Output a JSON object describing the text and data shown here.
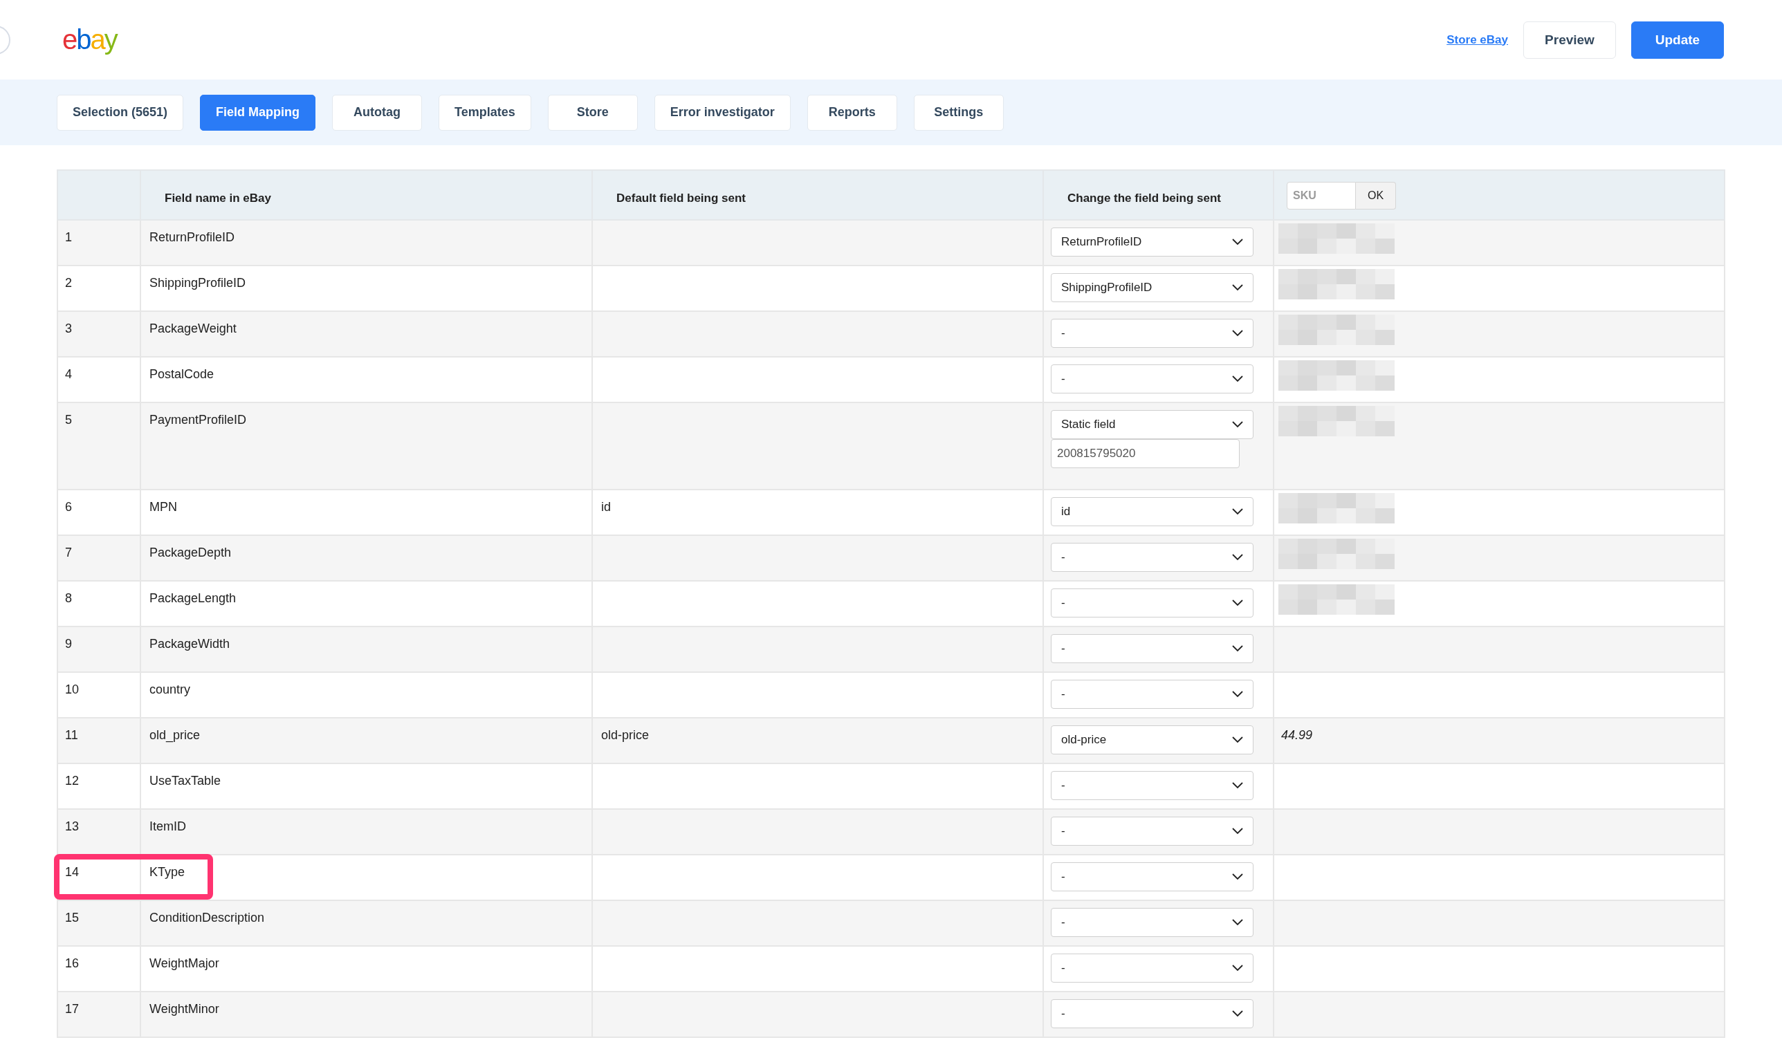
{
  "logo": {
    "letters": [
      {
        "char": "e",
        "color": "#e53238"
      },
      {
        "char": "b",
        "color": "#0064d2"
      },
      {
        "char": "a",
        "color": "#f5af02"
      },
      {
        "char": "y",
        "color": "#86b817"
      }
    ]
  },
  "header_actions": {
    "link": "Store eBay",
    "buttons": [
      {
        "label": "Preview",
        "kind": "secondary"
      },
      {
        "label": "Update",
        "kind": "primary"
      }
    ]
  },
  "tabs": [
    {
      "label": "Selection (5651)",
      "selected": false
    },
    {
      "label": "Field Mapping",
      "selected": true
    },
    {
      "label": "Autotag",
      "selected": false
    },
    {
      "label": "Templates",
      "selected": false
    },
    {
      "label": "Store",
      "selected": false
    },
    {
      "label": "Error investigator",
      "selected": false
    },
    {
      "label": "Reports",
      "selected": false
    },
    {
      "label": "Settings",
      "selected": false
    }
  ],
  "table": {
    "columns": [
      "Field name in eBay",
      "Default field being sent",
      "Change the field being sent"
    ],
    "sku_search": {
      "placeholder": "SKU",
      "button": "OK"
    },
    "rows": [
      {
        "n": "1",
        "field": "ReturnProfileID",
        "select": "ReturnProfileID",
        "blurred": true,
        "highlighted": false
      },
      {
        "n": "2",
        "field": "ShippingProfileID",
        "select": "ShippingProfileID",
        "blurred": true,
        "highlighted": false
      },
      {
        "n": "3",
        "field": "PackageWeight",
        "select": "-",
        "blurred": true,
        "highlighted": false
      },
      {
        "n": "4",
        "field": "PostalCode",
        "select": "-",
        "blurred": true,
        "highlighted": false
      },
      {
        "n": "5",
        "field": "PaymentProfileID",
        "select": "Static field",
        "static_value": "200815795020",
        "blurred": true,
        "highlighted": false
      },
      {
        "n": "6",
        "field": "MPN",
        "default": "id",
        "select": "id",
        "blurred": true,
        "highlighted": false
      },
      {
        "n": "7",
        "field": "PackageDepth",
        "select": "-",
        "blurred": true,
        "highlighted": false
      },
      {
        "n": "8",
        "field": "PackageLength",
        "select": "-",
        "blurred": true,
        "highlighted": false
      },
      {
        "n": "9",
        "field": "PackageWidth",
        "select": "-",
        "blurred": false,
        "highlighted": false
      },
      {
        "n": "10",
        "field": "country",
        "select": "-",
        "blurred": false,
        "highlighted": false
      },
      {
        "n": "11",
        "field": "old_price",
        "default": "old-price",
        "select": "old-price",
        "preview": "44.99",
        "blurred": false,
        "highlighted": false
      },
      {
        "n": "12",
        "field": "UseTaxTable",
        "select": "-",
        "blurred": false,
        "highlighted": false
      },
      {
        "n": "13",
        "field": "ItemID",
        "select": "-",
        "blurred": false,
        "highlighted": false
      },
      {
        "n": "14",
        "field": "KType",
        "select": "-",
        "blurred": false,
        "highlighted": true
      },
      {
        "n": "15",
        "field": "ConditionDescription",
        "select": "-",
        "blurred": false,
        "highlighted": false
      },
      {
        "n": "16",
        "field": "WeightMajor",
        "select": "-",
        "blurred": false,
        "highlighted": false
      },
      {
        "n": "17",
        "field": "WeightMinor",
        "select": "-",
        "blurred": false,
        "highlighted": false
      }
    ]
  }
}
